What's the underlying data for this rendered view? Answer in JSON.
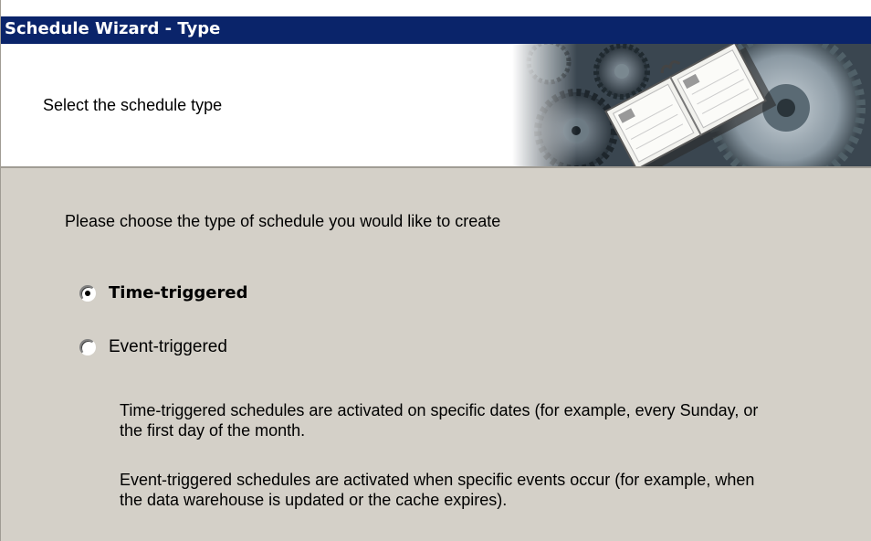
{
  "window": {
    "title": "Schedule Wizard - Type"
  },
  "header": {
    "subtitle": "Select the schedule type",
    "banner_icon": "calendar-gears-banner"
  },
  "main": {
    "prompt": "Please choose the type of schedule you would like to create",
    "options": [
      {
        "label": "Time-triggered",
        "selected": true
      },
      {
        "label": "Event-triggered",
        "selected": false
      }
    ],
    "descriptions": [
      "Time-triggered schedules are activated on specific dates (for example, every Sunday, or the first day of the month.",
      "Event-triggered schedules are activated when specific events occur (for example, when the data warehouse is  updated or the cache expires)."
    ]
  },
  "colors": {
    "titlebar": "#0a246a",
    "dialog_bg": "#d4d0c8",
    "header_bg": "#ffffff"
  }
}
